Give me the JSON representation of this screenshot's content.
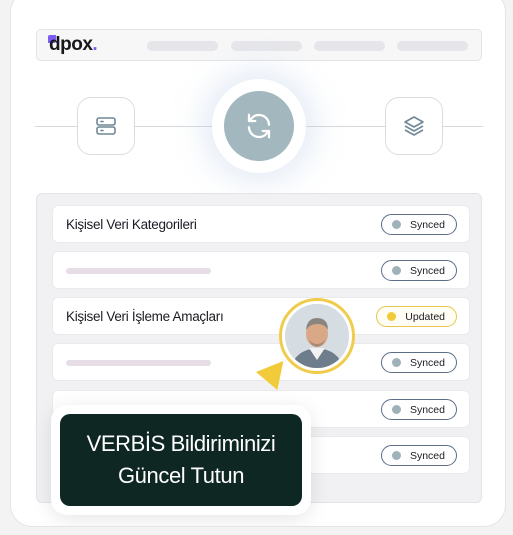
{
  "brand": {
    "logo_text": "dpox",
    "logo_dot": "."
  },
  "colors": {
    "brand_accent": "#7c5cf5",
    "synced_dot": "#9fb1b9",
    "updated_dot": "#f2cb3a",
    "callout_bg": "#0e2723"
  },
  "connector": {
    "left_icon": "server-icon",
    "center_icon": "sync-icon",
    "right_icon": "layers-icon"
  },
  "rows": [
    {
      "label": "Kişisel Veri Kategorileri",
      "status": "Synced"
    },
    {
      "label": "",
      "status": "Synced"
    },
    {
      "label": "Kişisel Veri İşleme Amaçları",
      "status": "Updated"
    },
    {
      "label": "",
      "status": "Synced"
    },
    {
      "label": "",
      "status": "Synced"
    },
    {
      "label": "",
      "status": "Synced"
    }
  ],
  "callout": {
    "line1": "VERBİS Bildiriminizi",
    "line2": "Güncel Tutun"
  }
}
